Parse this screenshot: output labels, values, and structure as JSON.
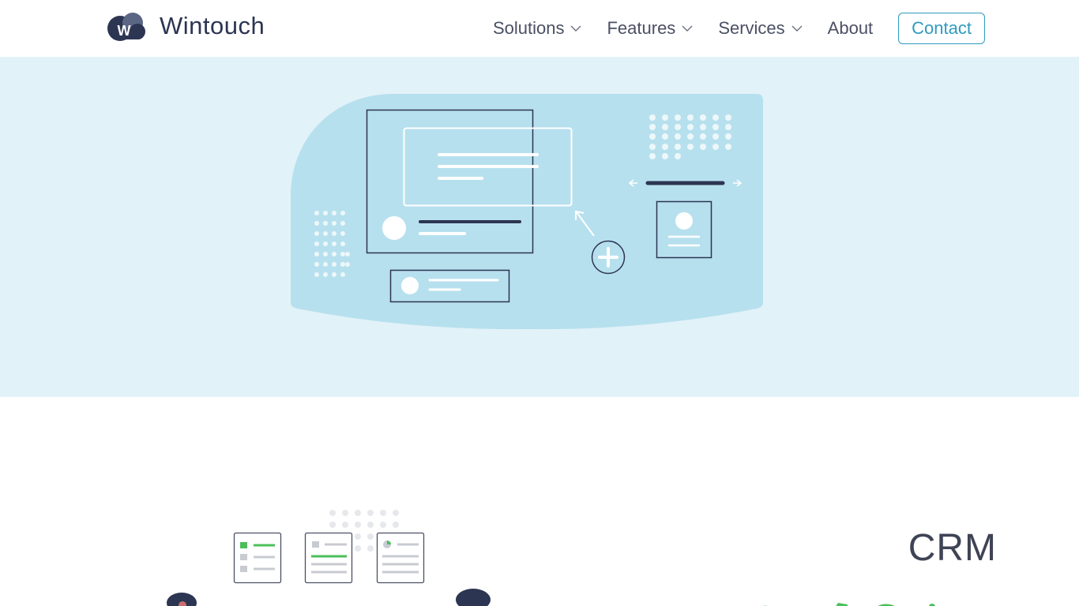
{
  "brand": {
    "name": "Wintouch",
    "logo_letter": "W"
  },
  "nav": {
    "items": [
      {
        "label": "Solutions",
        "has_dropdown": true,
        "icon": "chevron-down-icon"
      },
      {
        "label": "Features",
        "has_dropdown": true,
        "icon": "chevron-down-icon"
      },
      {
        "label": "Services",
        "has_dropdown": true,
        "icon": "chevron-down-icon"
      },
      {
        "label": "About",
        "has_dropdown": false
      }
    ],
    "contact_label": "Contact"
  },
  "hero": {
    "illustration": "contact-management-illustration"
  },
  "section2": {
    "title": "CRM",
    "illustration": "crm-checklist-illustration"
  },
  "colors": {
    "brand_navy": "#2c3552",
    "accent_blue": "#2e9bbf",
    "hero_bg": "#e1f2f8",
    "illustration_blue": "#b7e0ee",
    "accent_green": "#4cbf5a"
  }
}
